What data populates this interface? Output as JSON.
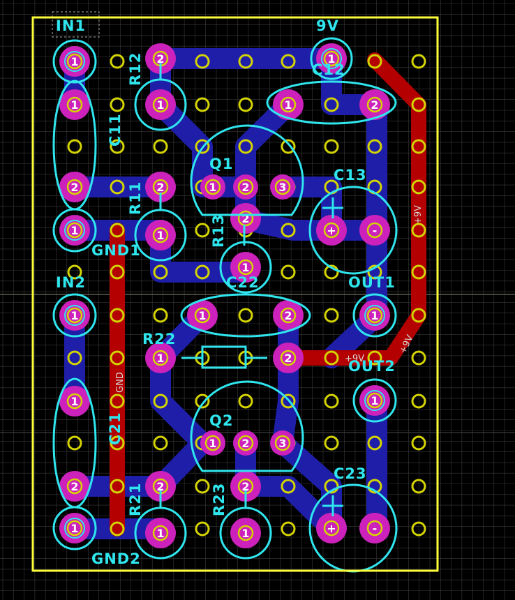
{
  "colors": {
    "background": "#000000",
    "grid": "#3a3a3a",
    "board_outline": "#ffff3a",
    "bottom_copper": "#1e1ea8",
    "top_copper": "#b40000",
    "silkscreen": "#2fe6ee",
    "pad": "#cc22bb",
    "via_ring": "#d4d400",
    "net_label": "#d8d8d8"
  },
  "labels": {
    "in1": "IN1",
    "nine_v": "9V",
    "r12": "R12",
    "c12": "C12",
    "c11": "C11",
    "q1": "Q1",
    "c13": "C13",
    "r11": "R11",
    "r13": "R13",
    "gnd1": "GND1",
    "c22": "C22",
    "in2": "IN2",
    "out1": "OUT1",
    "r22": "R22",
    "out2": "OUT2",
    "c21": "C21",
    "q2": "Q2",
    "c23": "C23",
    "r21": "R21",
    "r23": "R23",
    "gnd2": "GND2"
  },
  "net_labels": {
    "plus9v_right": "+9V",
    "plus9v_lower": "+9V",
    "plus9v_small": "+9V",
    "gnd_trace": "GND"
  },
  "pad_numbers": {
    "one": "1",
    "two": "2",
    "three": "3",
    "plus": "+",
    "minus": "-"
  }
}
